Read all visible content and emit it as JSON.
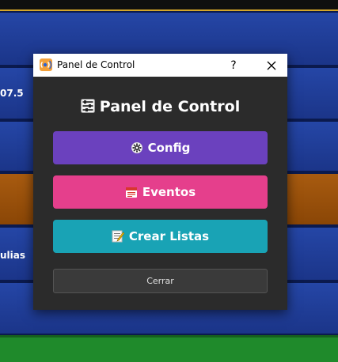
{
  "background": {
    "rows": [
      {
        "text": ""
      },
      {
        "text": "07.5"
      },
      {
        "text": ""
      },
      {
        "text": ""
      },
      {
        "text": "ulias"
      },
      {
        "text": ""
      }
    ]
  },
  "dialog": {
    "window_title": "Panel de Control",
    "help_label": "?",
    "heading": "Panel de Control",
    "buttons": {
      "config": "Config",
      "eventos": "Eventos",
      "crear_listas": "Crear Listas",
      "cerrar": "Cerrar"
    },
    "icons": {
      "app": "app-radio-icon",
      "heading": "control-panel-icon",
      "config": "gear-icon",
      "eventos": "calendar-icon",
      "crear_listas": "memo-icon",
      "close": "close-icon"
    },
    "colors": {
      "config": "#6b41be",
      "eventos": "#e53f8c",
      "crear_listas": "#19a3b5",
      "dialog_bg": "#2b2b2b"
    }
  }
}
